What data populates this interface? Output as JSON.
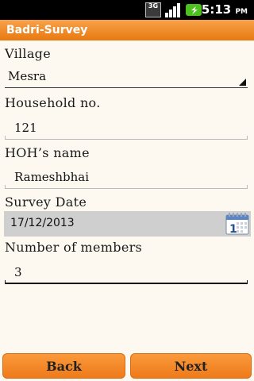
{
  "status_bar": {
    "network": "3G",
    "time": "5:13",
    "ampm": "PM"
  },
  "app": {
    "title": "Badri-Survey"
  },
  "form": {
    "village": {
      "label": "Village",
      "value": "Mesra"
    },
    "household": {
      "label": "Household no.",
      "value": "121"
    },
    "hoh": {
      "label": "HOH’s name",
      "value": "Rameshbhai"
    },
    "survey_date": {
      "label": "Survey Date",
      "value": "17/12/2013"
    },
    "members": {
      "label": "Number of members",
      "value": "3"
    }
  },
  "buttons": {
    "back": "Back",
    "next": "Next"
  },
  "colors": {
    "accent": "#f08a24",
    "field_gray": "#cfcfcf",
    "background": "#fdf9f0"
  },
  "icons": [
    "3g-icon",
    "signal-icon",
    "battery-charging-icon",
    "calendar-icon"
  ]
}
